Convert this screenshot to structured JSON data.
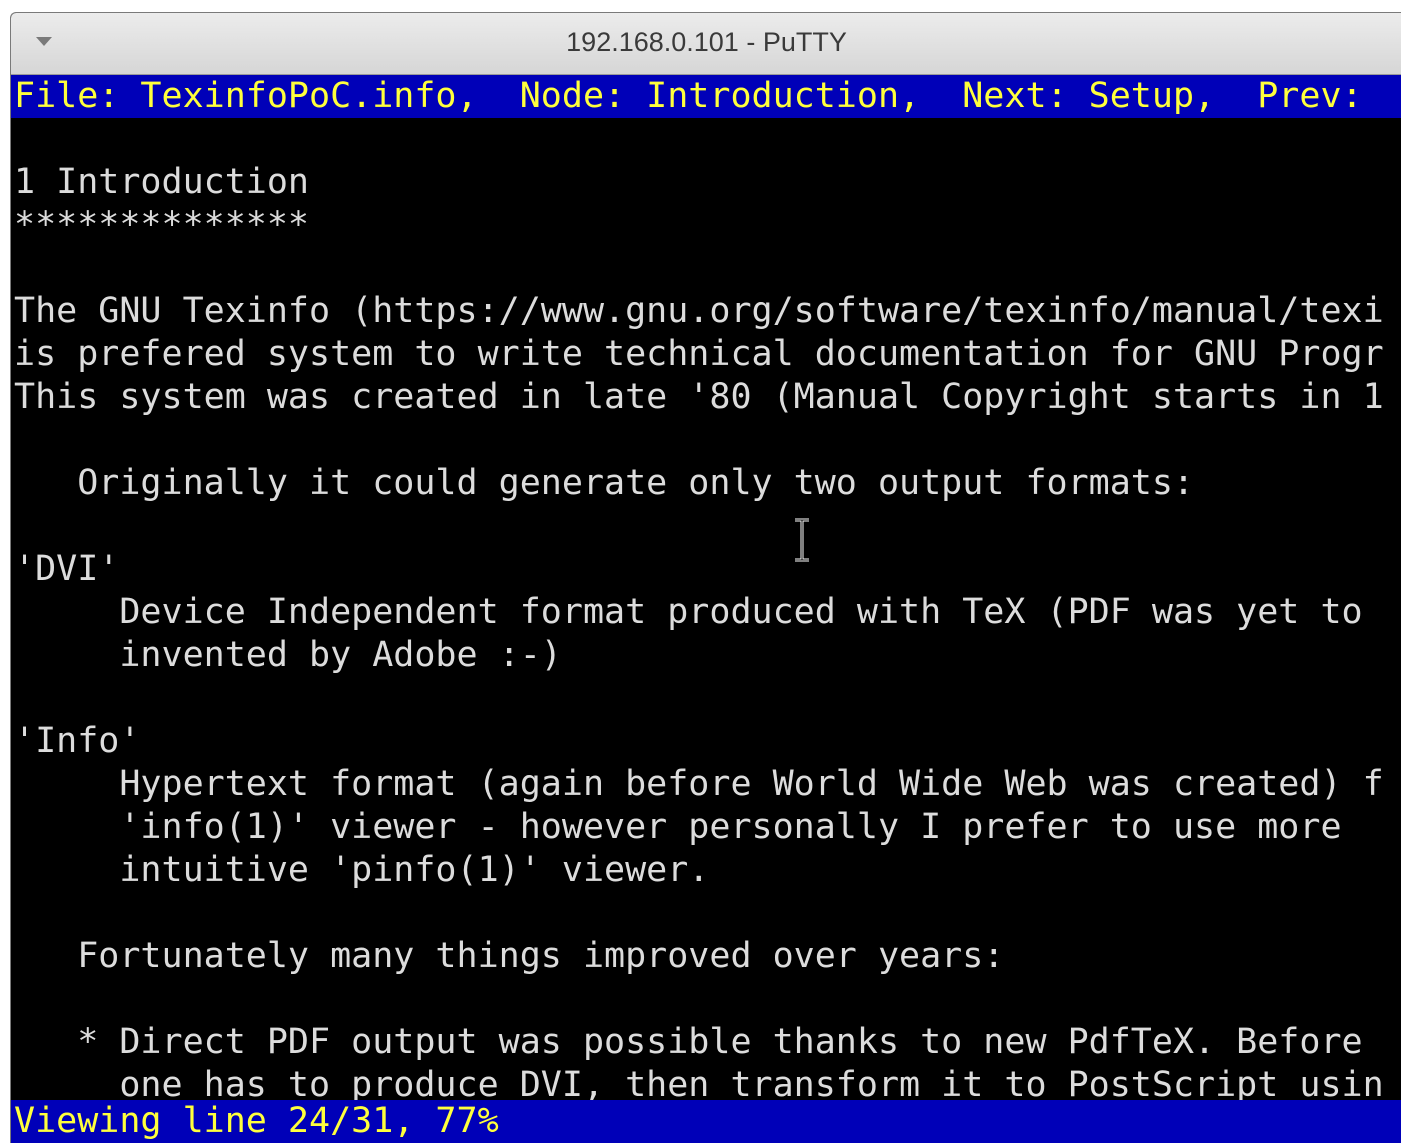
{
  "window": {
    "title": "192.168.0.101 - PuTTY"
  },
  "header": {
    "text": "File: TexinfoPoC.info,  Node: Introduction,  Next: Setup,  Prev:"
  },
  "lines": [
    "",
    "1 Introduction",
    "**************",
    "",
    "The GNU Texinfo (https://www.gnu.org/software/texinfo/manual/texi",
    "is prefered system to write technical documentation for GNU Progr",
    "This system was created in late '80 (Manual Copyright starts in 1",
    "",
    "   Originally it could generate only two output formats:",
    "",
    "'DVI'",
    "     Device Independent format produced with TeX (PDF was yet to",
    "     invented by Adobe :-)",
    "",
    "'Info'",
    "     Hypertext format (again before World Wide Web was created) f",
    "     'info(1)' viewer - however personally I prefer to use more",
    "     intuitive 'pinfo(1)' viewer.",
    "",
    "   Fortunately many things improved over years:",
    "",
    "   * Direct PDF output was possible thanks to new PdfTeX. Before",
    "     one has to produce DVI, then transform it to PostScript usin"
  ],
  "status": {
    "text": "Viewing line 24/31, 77%"
  },
  "colors": {
    "bar_background": "#0000b8",
    "bar_text": "#ffff3c",
    "terminal_background": "#000000",
    "terminal_text": "#dcdcdc"
  }
}
